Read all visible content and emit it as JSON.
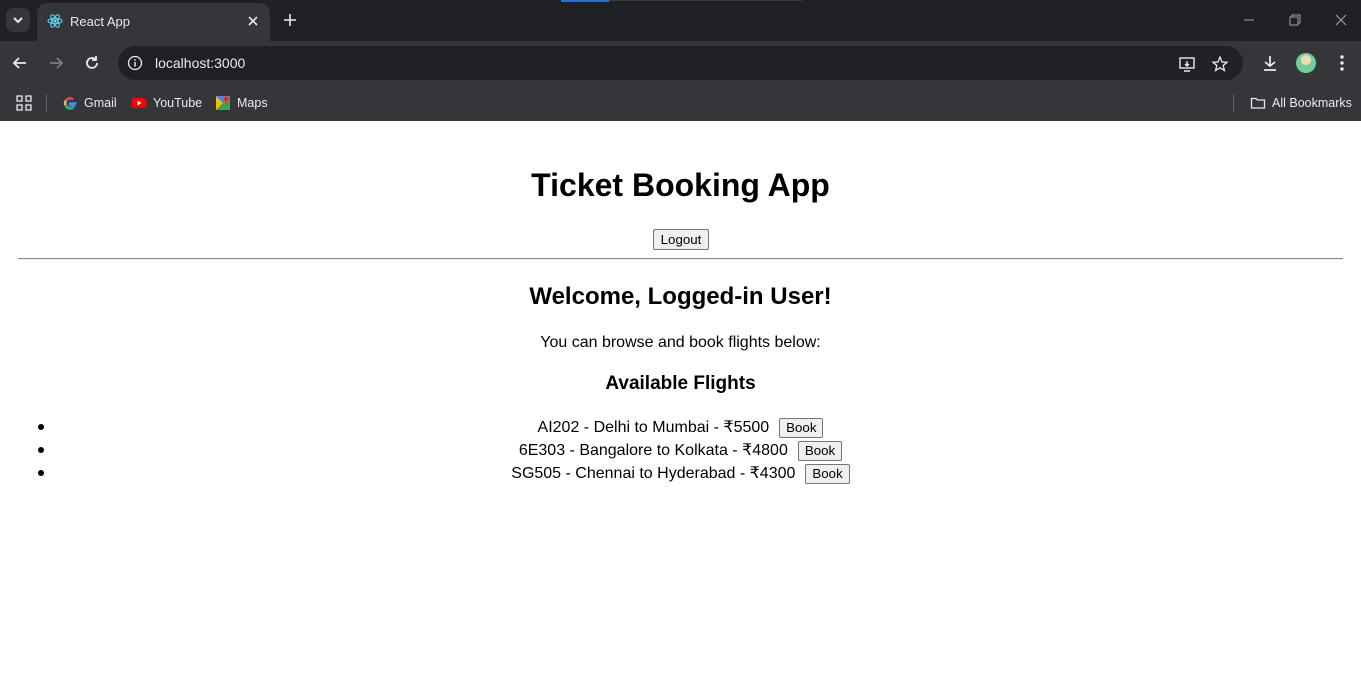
{
  "browser": {
    "tab_title": "React App",
    "url": "localhost:3000",
    "bookmarks": [
      {
        "label": "Gmail",
        "icon": "gmail-icon"
      },
      {
        "label": "YouTube",
        "icon": "youtube-icon"
      },
      {
        "label": "Maps",
        "icon": "maps-icon"
      }
    ],
    "all_bookmarks_label": "All Bookmarks"
  },
  "app": {
    "title": "Ticket Booking App",
    "logout_label": "Logout",
    "welcome": "Welcome, Logged-in User!",
    "intro": "You can browse and book flights below:",
    "flights_heading": "Available Flights",
    "flights": [
      {
        "text": "AI202 - Delhi to Mumbai - ₹5500",
        "button": "Book"
      },
      {
        "text": "6E303 - Bangalore to Kolkata - ₹4800",
        "button": "Book"
      },
      {
        "text": "SG505 - Chennai to Hyderabad - ₹4300",
        "button": "Book"
      }
    ]
  }
}
